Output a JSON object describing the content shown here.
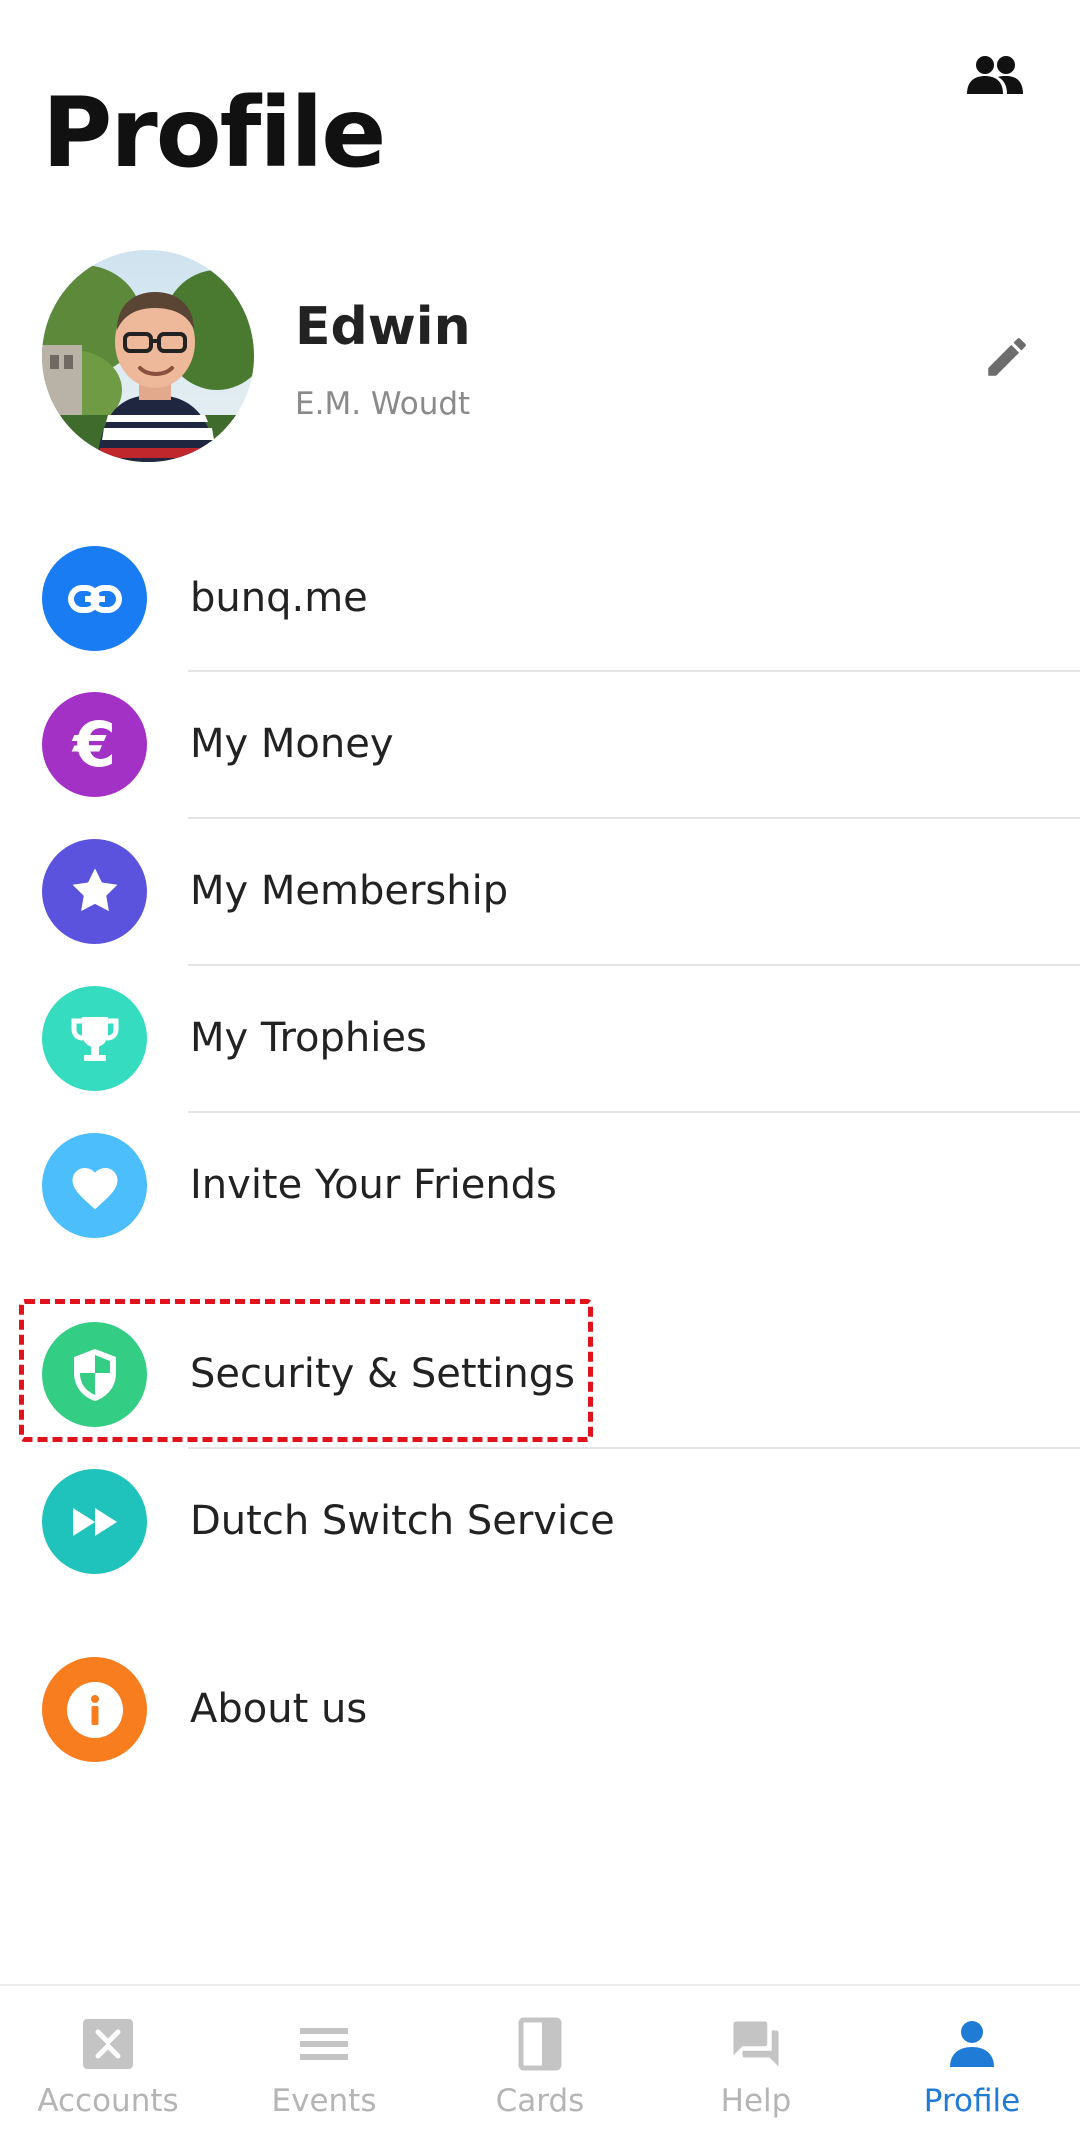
{
  "header": {
    "title": "Profile",
    "people_icon": "people-icon"
  },
  "profile": {
    "name": "Edwin",
    "subtitle": "E.M. Woudt",
    "edit_icon": "pencil-icon"
  },
  "menu": [
    {
      "label": "bunq.me",
      "icon": "link-icon",
      "color": "#1a7cf2"
    },
    {
      "label": "My Money",
      "icon": "euro-icon",
      "color": "#a431c6"
    },
    {
      "label": "My Membership",
      "icon": "star-icon",
      "color": "#5b52dd"
    },
    {
      "label": "My Trophies",
      "icon": "trophy-icon",
      "color": "#35dcc0"
    },
    {
      "label": "Invite Your Friends",
      "icon": "heart-icon",
      "color": "#4bbefb"
    },
    {
      "label": "Security & Settings",
      "icon": "shield-icon",
      "color": "#34cd84",
      "highlighted": true
    },
    {
      "label": "Dutch Switch Service",
      "icon": "fast-forward-icon",
      "color": "#20c3bc"
    },
    {
      "label": "About us",
      "icon": "info-icon",
      "color": "#f87d1f"
    }
  ],
  "highlight_color": "#e0121b",
  "tabs": [
    {
      "label": "Accounts",
      "icon": "accounts-icon",
      "active": false
    },
    {
      "label": "Events",
      "icon": "list-icon",
      "active": false
    },
    {
      "label": "Cards",
      "icon": "cards-icon",
      "active": false
    },
    {
      "label": "Help",
      "icon": "chat-icon",
      "active": false
    },
    {
      "label": "Profile",
      "icon": "person-icon",
      "active": true
    }
  ],
  "colors": {
    "tab_active": "#1f7bd6",
    "tab_inactive": "#b5b5b5"
  }
}
